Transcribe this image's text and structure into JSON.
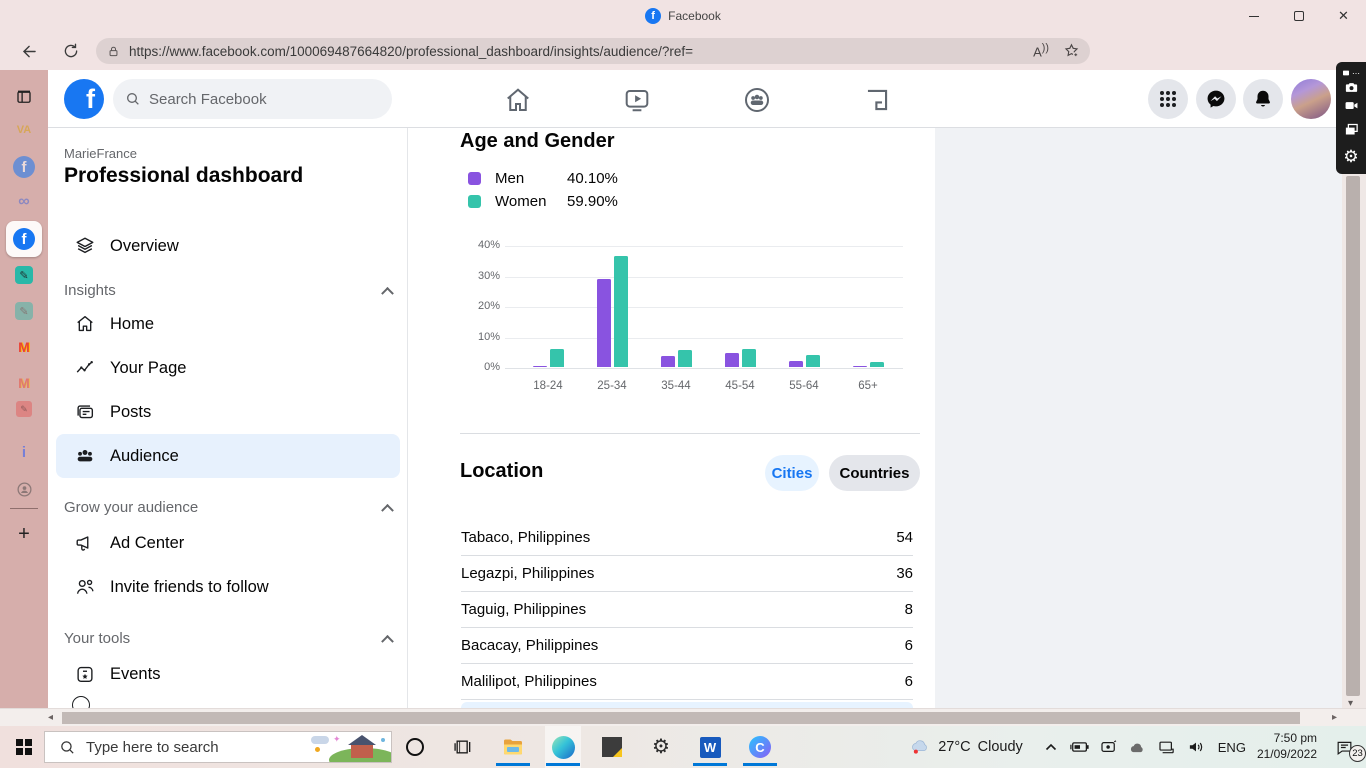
{
  "browser": {
    "title": "Facebook",
    "url": "https://www.facebook.com/100069487664820/professional_dashboard/insights/audience/?ref="
  },
  "icons": {
    "back": "←",
    "refresh": "↻",
    "read_aloud": "A",
    "more": "⋯",
    "close": "✕",
    "divider": "|",
    "down_arrow": "▾",
    "left_arrow": "◂",
    "right_arrow": "▸",
    "fb_f": "f",
    "meta": "∞",
    "va": "VA",
    "gmail_m": "M",
    "pencil": "✎",
    "info_i": "i",
    "plus": "+",
    "gear": "⚙",
    "word_w": "W",
    "camtasia_c": "C",
    "spark": "✦"
  },
  "fb": {
    "search_placeholder": "Search Facebook"
  },
  "sidebar": {
    "page_name": "MarieFrance",
    "title": "Professional dashboard",
    "overview": "Overview",
    "sections": [
      {
        "label": "Insights",
        "items": [
          {
            "label": "Home"
          },
          {
            "label": "Your Page"
          },
          {
            "label": "Posts"
          },
          {
            "label": "Audience"
          }
        ]
      },
      {
        "label": "Grow your audience",
        "items": [
          {
            "label": "Ad Center"
          },
          {
            "label": "Invite friends to follow"
          }
        ]
      },
      {
        "label": "Your tools",
        "items": [
          {
            "label": "Events"
          }
        ]
      }
    ]
  },
  "main": {
    "location": {
      "title": "Location",
      "tabs": [
        {
          "label": "Cities"
        },
        {
          "label": "Countries"
        }
      ],
      "active_tab": "Cities",
      "rows": [
        {
          "name": "Tabaco, Philippines",
          "value": "54"
        },
        {
          "name": "Legazpi, Philippines",
          "value": "36"
        },
        {
          "name": "Taguig, Philippines",
          "value": "8"
        },
        {
          "name": "Bacacay, Philippines",
          "value": "6"
        },
        {
          "name": "Malilipot, Philippines",
          "value": "6"
        }
      ]
    }
  },
  "chart_data": {
    "type": "bar",
    "title": "Age and Gender",
    "categories": [
      "18-24",
      "25-34",
      "35-44",
      "45-54",
      "55-64",
      "65+"
    ],
    "series": [
      {
        "name": "Men",
        "share": "40.10%",
        "color": "#8953e0",
        "values": [
          0.5,
          29,
          3.5,
          4.5,
          2,
          0.5
        ]
      },
      {
        "name": "Women",
        "share": "59.90%",
        "color": "#35c4ab",
        "values": [
          6,
          36.5,
          5.5,
          6,
          4,
          1.5
        ]
      }
    ],
    "y_ticks": [
      "40%",
      "30%",
      "20%",
      "10%",
      "0%"
    ],
    "ylim": [
      0,
      40
    ],
    "grid": true,
    "legend_position": "top-left"
  },
  "taskbar": {
    "search_placeholder": "Type here to search",
    "weather_temp": "27°C",
    "weather_condition": "Cloudy",
    "language": "ENG",
    "time": "7:50 pm",
    "date": "21/09/2022",
    "notification_count": "23"
  }
}
